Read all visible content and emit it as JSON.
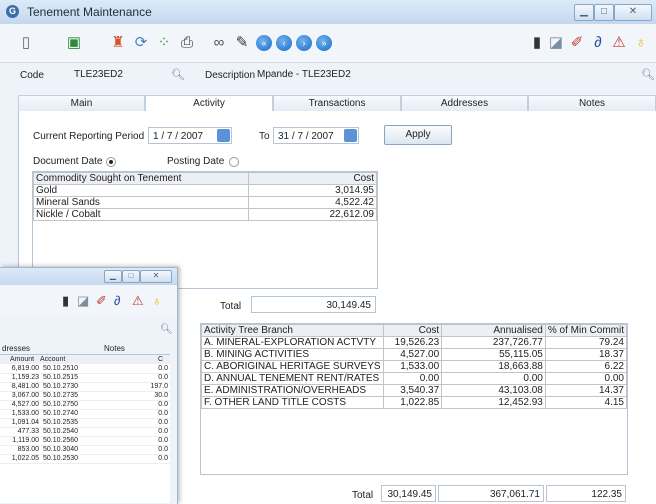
{
  "window": {
    "title": "Tenement Maintenance"
  },
  "form": {
    "code_label": "Code",
    "code_value": "TLE23ED2",
    "description_label": "Description",
    "description_value": "Mpande - TLE23ED2"
  },
  "tabs": [
    "Main",
    "Activity",
    "Transactions",
    "Addresses",
    "Notes"
  ],
  "activity": {
    "period_label": "Current Reporting Period",
    "from_date": "1 / 7 / 2007",
    "to_label": "To",
    "to_date": "31 / 7 / 2007",
    "apply_label": "Apply",
    "document_date_label": "Document Date",
    "posting_date_label": "Posting Date",
    "commodity": {
      "headers": [
        "Commodity Sought on Tenement",
        "Cost"
      ],
      "rows": [
        [
          "Gold",
          "3,014.95"
        ],
        [
          "Mineral Sands",
          "4,522.42"
        ],
        [
          "Nickle / Cobalt",
          "22,612.09"
        ]
      ]
    },
    "total_label": "Total",
    "total_value": "30,149.45",
    "tree": {
      "headers": [
        "Activity Tree Branch",
        "Cost",
        "Annualised",
        "% of Min Commit"
      ],
      "rows": [
        [
          "A. MINERAL-EXPLORATION ACTVTY",
          "19,526.23",
          "237,726.77",
          "79.24"
        ],
        [
          "B. MINING ACTIVITIES",
          "4,527.00",
          "55,115.05",
          "18.37"
        ],
        [
          "C. ABORIGINAL HERITAGE SURVEYS",
          "1,533.00",
          "18,663.88",
          "6.22"
        ],
        [
          "D. ANNUAL TENEMENT RENT/RATES",
          "0.00",
          "0.00",
          "0.00"
        ],
        [
          "E. ADMINISTRATION/OVERHEADS",
          "3,540.37",
          "43,103.08",
          "14.37"
        ],
        [
          "F. OTHER LAND TITLE COSTS",
          "1,022.85",
          "12,452.93",
          "4.15"
        ]
      ],
      "total_label": "Total",
      "total_cost": "30,149.45",
      "total_annualised": "367,061.71",
      "total_pct": "122.35"
    }
  },
  "window2": {
    "tabs": [
      "dresses",
      "Notes"
    ],
    "headers": [
      "Amount",
      "Account",
      "C"
    ],
    "rows": [
      [
        "6,819.00",
        "50.10.2510",
        "0.0"
      ],
      [
        "1,159.23",
        "50.10.2515",
        "0.0"
      ],
      [
        "8,481.00",
        "50.10.2730",
        "197.0"
      ],
      [
        "3,067.00",
        "50.10.2735",
        "30.0"
      ],
      [
        "4,527.00",
        "50.10.2750",
        "0.0"
      ],
      [
        "1,533.00",
        "50.10.2740",
        "0.0"
      ],
      [
        "1,091.04",
        "50.10.2535",
        "0.0"
      ],
      [
        "477.33",
        "50.10.2540",
        "0.0"
      ],
      [
        "1,119.00",
        "50.10.2560",
        "0.0"
      ],
      [
        "853.00",
        "50.10.3040",
        "0.0"
      ],
      [
        "1,022.05",
        "50.10.2530",
        "0.0"
      ]
    ]
  }
}
